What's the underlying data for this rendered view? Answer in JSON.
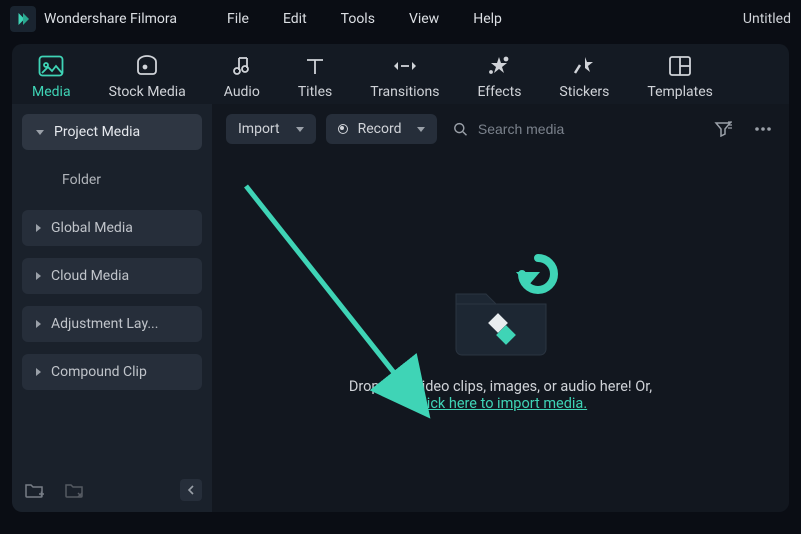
{
  "app": {
    "name": "Wondershare Filmora",
    "document": "Untitled"
  },
  "menu": {
    "file": "File",
    "edit": "Edit",
    "tools": "Tools",
    "view": "View",
    "help": "Help"
  },
  "tabs": {
    "media": "Media",
    "stock": "Stock Media",
    "audio": "Audio",
    "titles": "Titles",
    "transitions": "Transitions",
    "effects": "Effects",
    "stickers": "Stickers",
    "templates": "Templates"
  },
  "sidebar": {
    "project": "Project Media",
    "folder": "Folder",
    "global": "Global Media",
    "cloud": "Cloud Media",
    "adjustment": "Adjustment Lay...",
    "compound": "Compound Clip"
  },
  "toolbar": {
    "import": "Import",
    "record": "Record",
    "search_placeholder": "Search media"
  },
  "dropzone": {
    "text": "Drop your video clips, images, or audio here! Or,",
    "link": "Click here to import media."
  }
}
